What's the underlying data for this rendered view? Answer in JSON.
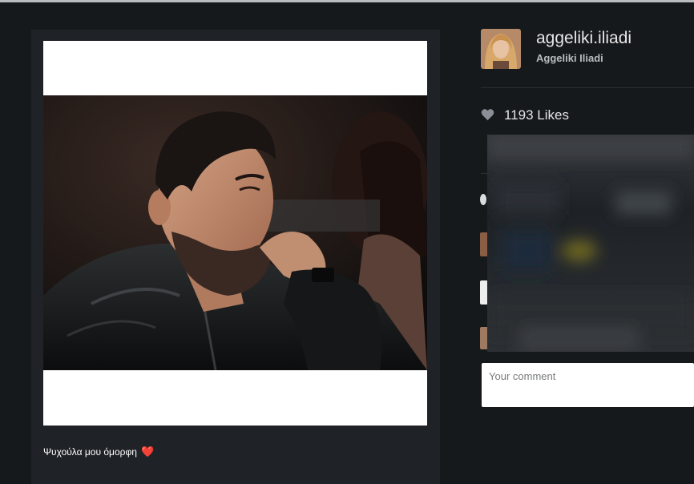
{
  "post": {
    "caption": "Ψυχούλα μου όμορφη",
    "caption_emoji": "❤️"
  },
  "profile": {
    "username": "aggeliki.iliadi",
    "full_name": "Aggeliki Iliadi"
  },
  "likes": {
    "count_text": "1193 Likes",
    "icon": "heart-icon"
  },
  "comment": {
    "placeholder": "Your comment",
    "value": ""
  },
  "colors": {
    "background": "#16191c",
    "card": "#1f2327",
    "text": "#e6e6e6",
    "heart": "#e3262e"
  }
}
